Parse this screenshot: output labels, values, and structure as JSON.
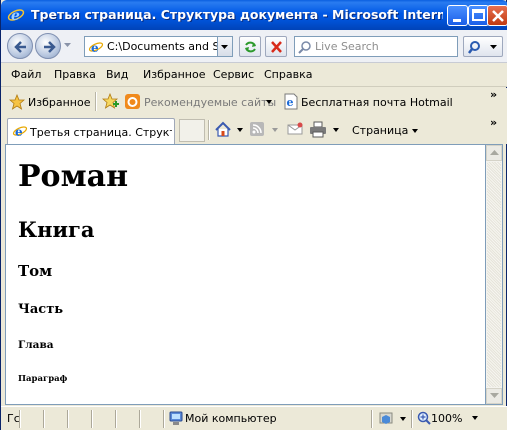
{
  "window": {
    "title": "Третья страница. Структура документа - Microsoft Internet Exp...",
    "titlebar_color": "#0054e3"
  },
  "address": {
    "value": "C:\\Documents and Set",
    "search_placeholder": "Live Search"
  },
  "menu": {
    "items": [
      {
        "label": "Файл"
      },
      {
        "label": "Правка"
      },
      {
        "label": "Вид"
      },
      {
        "label": "Избранное"
      },
      {
        "label": "Сервис"
      },
      {
        "label": "Справка"
      }
    ]
  },
  "favorites": {
    "label": "Избранное",
    "suggested_sites": "Рекомендуемые сайты",
    "hotmail": "Бесплатная почта Hotmail",
    "more": "»"
  },
  "tabs": {
    "active_label": "Третья страница. Структ...",
    "page_menu": "Страница",
    "more": "»"
  },
  "content": {
    "h1": "Роман",
    "h2": "Книга",
    "h3": "Том",
    "h4": "Часть",
    "h5": "Глава",
    "h6": "Параграф"
  },
  "status": {
    "text": "Гс",
    "zone": "Мой компьютер",
    "zoom": "100%"
  },
  "icons": {
    "app": "ie-icon",
    "back": "back-arrow-icon",
    "forward": "forward-arrow-icon",
    "refresh": "refresh-icon",
    "stop": "stop-icon",
    "search": "search-icon",
    "home": "home-icon",
    "rss": "rss-icon",
    "mail": "mail-icon",
    "print": "print-icon",
    "computer": "computer-icon",
    "zoom": "magnifier-icon"
  }
}
